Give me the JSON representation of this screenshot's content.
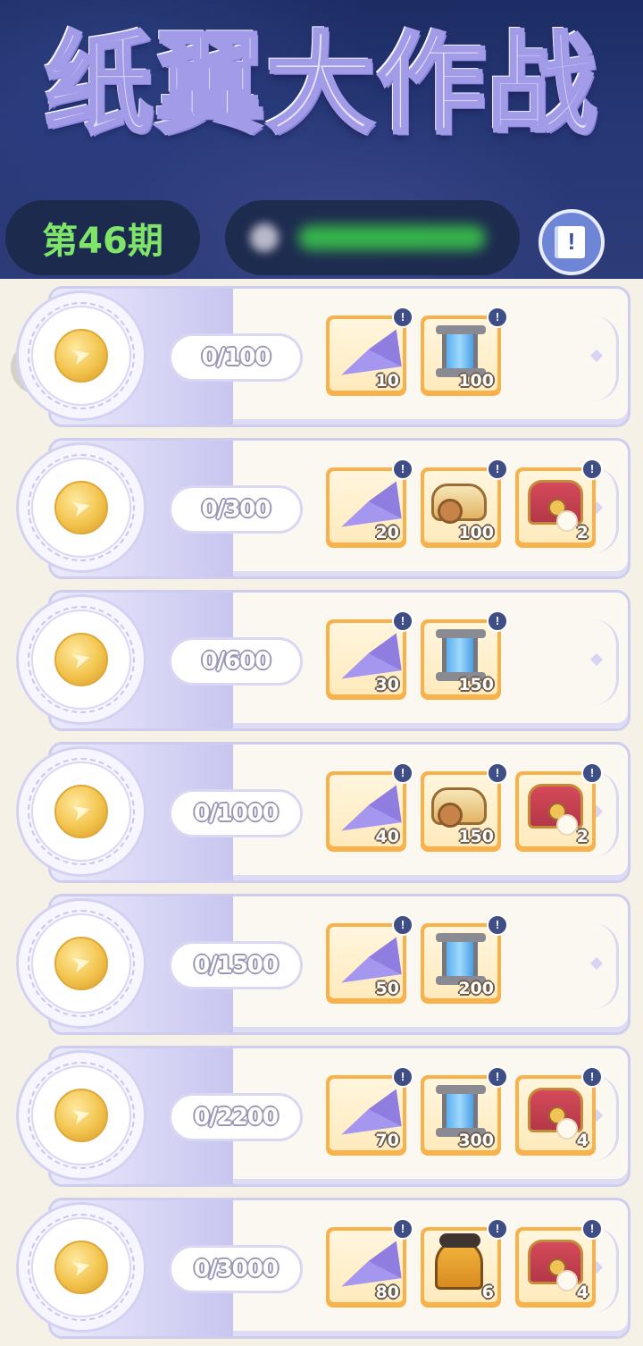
{
  "header": {
    "title": "纸翼大作战",
    "period": "第46期",
    "player_name": "",
    "book_button": "book-info"
  },
  "tiers": [
    {
      "progress": "0/100",
      "rewards": [
        {
          "item": "paper-plane",
          "qty": "10"
        },
        {
          "item": "energy-canister",
          "qty": "100"
        }
      ]
    },
    {
      "progress": "0/300",
      "rewards": [
        {
          "item": "paper-plane",
          "qty": "20"
        },
        {
          "item": "bread-roll",
          "qty": "100"
        },
        {
          "item": "treasure-chest",
          "qty": "2"
        }
      ]
    },
    {
      "progress": "0/600",
      "rewards": [
        {
          "item": "paper-plane",
          "qty": "30"
        },
        {
          "item": "energy-canister",
          "qty": "150"
        }
      ]
    },
    {
      "progress": "0/1000",
      "rewards": [
        {
          "item": "paper-plane",
          "qty": "40"
        },
        {
          "item": "bread-roll",
          "qty": "150"
        },
        {
          "item": "treasure-chest",
          "qty": "2"
        }
      ]
    },
    {
      "progress": "0/1500",
      "rewards": [
        {
          "item": "paper-plane",
          "qty": "50"
        },
        {
          "item": "energy-canister",
          "qty": "200"
        }
      ]
    },
    {
      "progress": "0/2200",
      "rewards": [
        {
          "item": "paper-plane",
          "qty": "70"
        },
        {
          "item": "energy-canister",
          "qty": "300"
        },
        {
          "item": "treasure-chest",
          "qty": "4"
        }
      ]
    },
    {
      "progress": "0/3000",
      "rewards": [
        {
          "item": "paper-plane",
          "qty": "80"
        },
        {
          "item": "golden-bell",
          "qty": "6"
        },
        {
          "item": "treasure-chest",
          "qty": "4"
        }
      ]
    }
  ]
}
